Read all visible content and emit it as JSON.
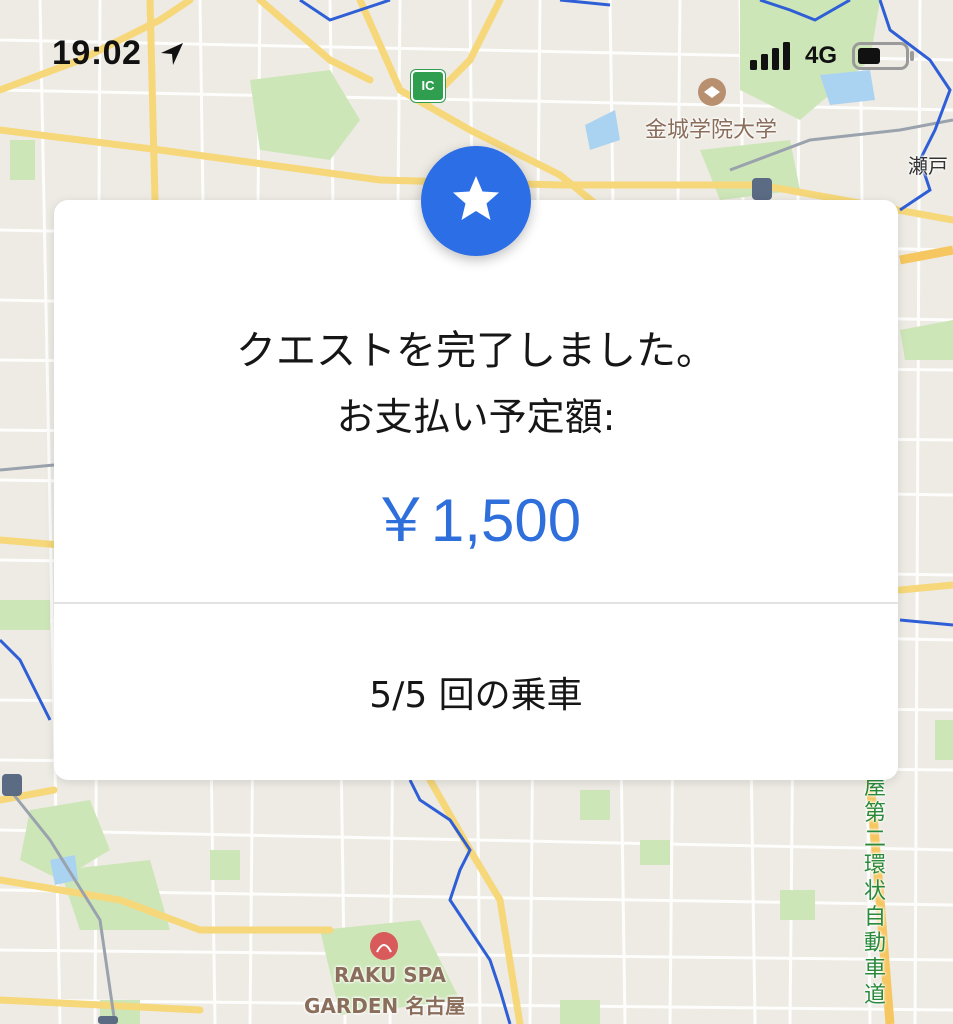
{
  "status_bar": {
    "time": "19:02",
    "network": "4G",
    "location_icon": "location-arrow-icon",
    "signal_icon": "cellular-signal-icon",
    "battery_icon": "battery-icon"
  },
  "map": {
    "labels": {
      "university": "金城学院大学",
      "seto": "瀬戸",
      "spa_line1": "RAKU SPA",
      "spa_line2": "GARDEN 名古屋",
      "expressway": "屋第二環状自動車道",
      "ic": "IC"
    },
    "colors": {
      "land": "#eeebe4",
      "road_major": "#f6d77a",
      "road_minor": "#ffffff",
      "park": "#cde6b8",
      "water": "#aad3f2",
      "boundary": "#2f5fd6"
    }
  },
  "quest_modal": {
    "badge_icon": "star-icon",
    "title": "クエストを完了しました。",
    "subtitle": "お支払い予定額:",
    "amount": "￥1,500",
    "rides": "5/5 回の乗車",
    "accent_color": "#2f6fdc"
  }
}
